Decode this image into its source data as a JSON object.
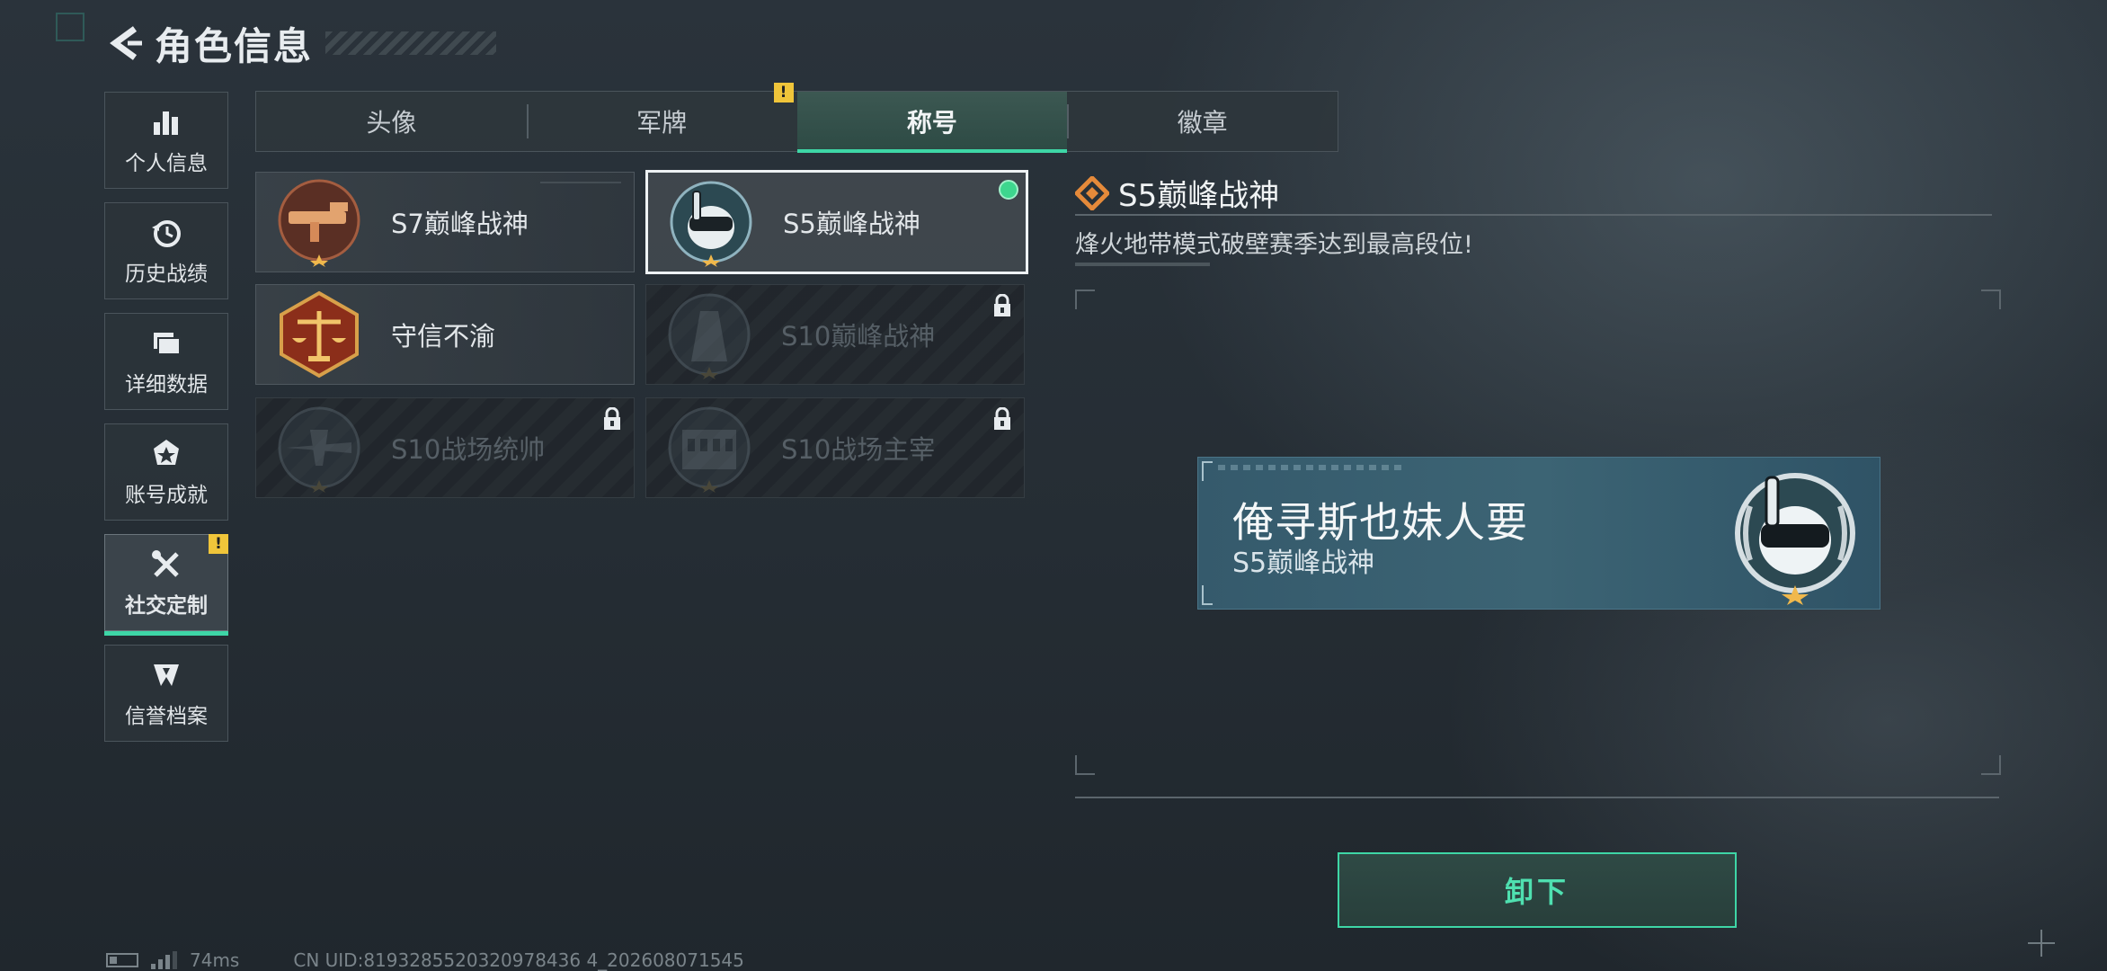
{
  "header": {
    "title": "角色信息"
  },
  "sidebar": {
    "items": [
      {
        "label": "个人信息",
        "icon": "bar-chart-icon",
        "active": false
      },
      {
        "label": "历史战绩",
        "icon": "history-clock-icon",
        "active": false
      },
      {
        "label": "详细数据",
        "icon": "folder-icon",
        "active": false
      },
      {
        "label": "账号成就",
        "icon": "achievement-medal-icon",
        "active": false
      },
      {
        "label": "社交定制",
        "icon": "wrench-screwdriver-icon",
        "active": true,
        "alert": "!"
      },
      {
        "label": "信誉档案",
        "icon": "credit-shield-icon",
        "active": false
      }
    ]
  },
  "tabs": [
    {
      "label": "头像",
      "active": false
    },
    {
      "label": "军牌",
      "active": false,
      "alert": "!"
    },
    {
      "label": "称号",
      "active": true
    },
    {
      "label": "徽章",
      "active": false
    }
  ],
  "titles": [
    {
      "name": "S7巅峰战神",
      "emblem": "s7-gun-emblem-icon",
      "locked": false,
      "selected": false
    },
    {
      "name": "S5巅峰战神",
      "emblem": "s5-diver-skull-emblem-icon",
      "locked": false,
      "selected": true,
      "equipped": true
    },
    {
      "name": "守信不渝",
      "emblem": "scales-emblem-icon",
      "locked": false,
      "selected": false
    },
    {
      "name": "S10巅峰战神",
      "emblem": "s10-tower-emblem-icon",
      "locked": true,
      "selected": false
    },
    {
      "name": "S10战场统帅",
      "emblem": "s10-aircraft-emblem-icon",
      "locked": true,
      "selected": false
    },
    {
      "name": "S10战场主宰",
      "emblem": "s10-colosseum-emblem-icon",
      "locked": true,
      "selected": false
    }
  ],
  "detail": {
    "title": "S5巅峰战神",
    "description": "烽火地带模式破壁赛季达到最高段位!"
  },
  "preview": {
    "player_name": "俺寻斯也妹人要",
    "title": "S5巅峰战神"
  },
  "unequip_button": "卸下",
  "status_bar": {
    "ping": "74ms",
    "uid": "CN UID:8193285520320978436 4_202608071545"
  },
  "colors": {
    "accent": "#3ed6a6",
    "warning": "#f0c53a",
    "equipped": "#3ed68e"
  }
}
